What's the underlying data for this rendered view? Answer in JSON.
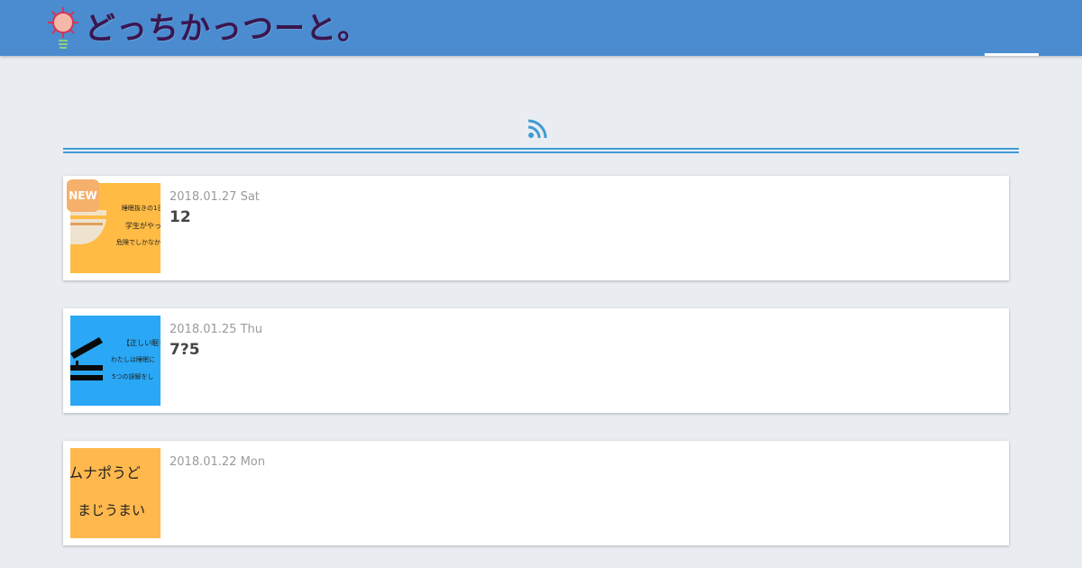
{
  "site": {
    "logo_text": "どっちかっつーと。",
    "logo_icon": "sun-lightbulb-icon"
  },
  "feed": {
    "rss_icon": "rss-icon",
    "rss_color": "#3f9bd4"
  },
  "colors": {
    "header_bg": "#4a8ccf",
    "page_bg": "#e9edf2",
    "accent": "#3f9bd4",
    "new_badge": "#f5b06b"
  },
  "posts": [
    {
      "date": "2018.01.27 Sat",
      "title": "12",
      "badge": "NEW",
      "thumb_bg": "#ffbb44",
      "thumb_lines": [
        "睡眠抜きの1日",
        "学生がやって",
        "危険でしかなか"
      ]
    },
    {
      "date": "2018.01.25 Thu",
      "title": "7?5",
      "badge": "",
      "thumb_bg": "#2aa8f5",
      "thumb_lines": [
        "【正しい眠り",
        "わたしは睡眠に",
        "5つの誤解をし"
      ]
    },
    {
      "date": "2018.01.22 Mon",
      "title": "",
      "badge": "",
      "thumb_bg": "#ffb84d",
      "thumb_lines": [
        "ムナポうど",
        "まじうまい"
      ]
    }
  ]
}
